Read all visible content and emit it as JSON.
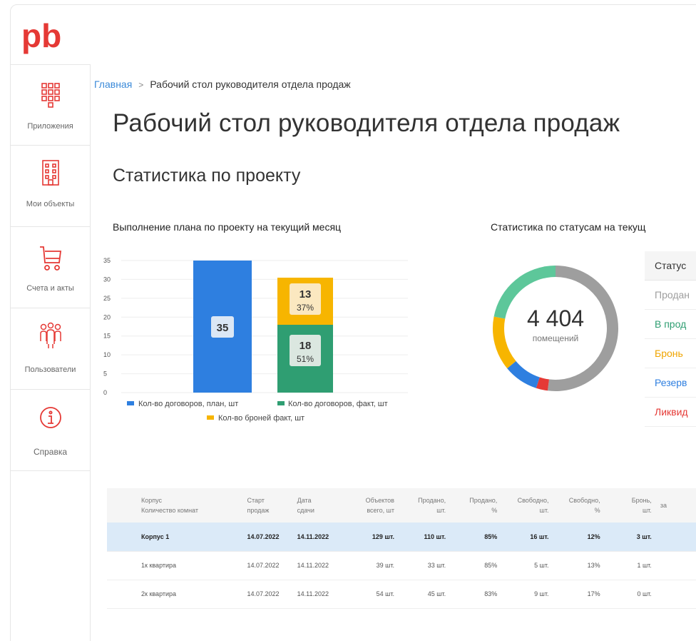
{
  "brand": {
    "logo_text": "pb",
    "color": "#e53935"
  },
  "sidebar": {
    "items": [
      {
        "label": "Приложения",
        "icon": "apps-grid-icon"
      },
      {
        "label": "Мои объекты",
        "icon": "building-icon"
      },
      {
        "label": "Счета и акты",
        "icon": "cart-icon"
      },
      {
        "label": "Пользователи",
        "icon": "users-icon"
      },
      {
        "label": "Справка",
        "icon": "info-icon"
      }
    ],
    "accent": "#e53935"
  },
  "breadcrumb": {
    "home": "Главная",
    "separator": ">",
    "current": "Рабочий стол руководителя отдела продаж"
  },
  "page_title": "Рабочий стол руководителя отдела продаж",
  "section_title": "Статистика по проекту",
  "plan_chart": {
    "title": "Выполнение плана по проекту на текущий месяц",
    "y_ticks": [
      "35",
      "30",
      "25",
      "20",
      "15",
      "10",
      "5",
      "0"
    ],
    "bar_plan": {
      "value": "35"
    },
    "bar_fact": {
      "value": "18",
      "pct": "51%"
    },
    "bar_booking": {
      "value": "13",
      "pct": "37%"
    },
    "legend": [
      {
        "label": "Кол-во договоров, план, шт",
        "color": "#2e7fe0"
      },
      {
        "label": "Кол-во договоров, факт, шт",
        "color": "#2f9e72"
      },
      {
        "label": "Кол-во броней факт, шт",
        "color": "#f7b500"
      }
    ]
  },
  "chart_data": {
    "type": "bar",
    "categories": [
      "",
      ""
    ],
    "series": [
      {
        "name": "Кол-во договоров, план, шт",
        "values": [
          35,
          0
        ]
      },
      {
        "name": "Кол-во договоров, факт, шт",
        "values": [
          0,
          18
        ]
      },
      {
        "name": "Кол-во броней факт, шт",
        "values": [
          0,
          13
        ]
      }
    ],
    "stacked": true,
    "ylim": [
      0,
      35
    ],
    "annotations": [
      "35",
      "18",
      "51%",
      "13",
      "37%"
    ],
    "legend_position": "bottom"
  },
  "status_chart": {
    "title": "Статистика по статусам на текущ",
    "total": "4 404",
    "total_label": "помещений",
    "segments": [
      {
        "name": "Продано",
        "value": 52,
        "color": "#9e9e9e"
      },
      {
        "name": "Ликвид",
        "value": 3,
        "color": "#e53935"
      },
      {
        "name": "Резерв",
        "value": 9,
        "color": "#2e7fe0"
      },
      {
        "name": "Бронь",
        "value": 14,
        "color": "#f7b500"
      },
      {
        "name": "В продаже",
        "value": 22,
        "color": "#5dc79a"
      }
    ]
  },
  "status_table": {
    "header": "Статус",
    "rows": [
      {
        "label": "Продан",
        "color": "#9e9e9e"
      },
      {
        "label": "В прод",
        "color": "#2f9e72"
      },
      {
        "label": "Бронь",
        "color": "#f0a500"
      },
      {
        "label": "Резерв",
        "color": "#2e7fe0"
      },
      {
        "label": "Ликвид",
        "color": "#e53935"
      }
    ]
  },
  "table": {
    "headers": [
      "Корпус\nКоличество комнат",
      "Старт\nпродаж",
      "Дата\nсдачи",
      "Объектов\nвсего, шт",
      "Продано,\nшт.",
      "Продано,\n%",
      "Свободно,\nшт.",
      "Свободно,\n%",
      "Бронь,\nшт.",
      "за"
    ],
    "rows": [
      {
        "cells": [
          "Корпус 1",
          "14.07.2022",
          "14.11.2022",
          "129 шт.",
          "110 шт.",
          "85%",
          "16 шт.",
          "12%",
          "3 шт.",
          ""
        ],
        "highlight": true
      },
      {
        "cells": [
          "1к квартира",
          "14.07.2022",
          "14.11.2022",
          "39 шт.",
          "33 шт.",
          "85%",
          "5 шт.",
          "13%",
          "1 шт.",
          ""
        ],
        "highlight": false
      },
      {
        "cells": [
          "2к квартира",
          "14.07.2022",
          "14.11.2022",
          "54 шт.",
          "45 шт.",
          "83%",
          "9 шт.",
          "17%",
          "0 шт.",
          ""
        ],
        "highlight": false
      }
    ]
  }
}
